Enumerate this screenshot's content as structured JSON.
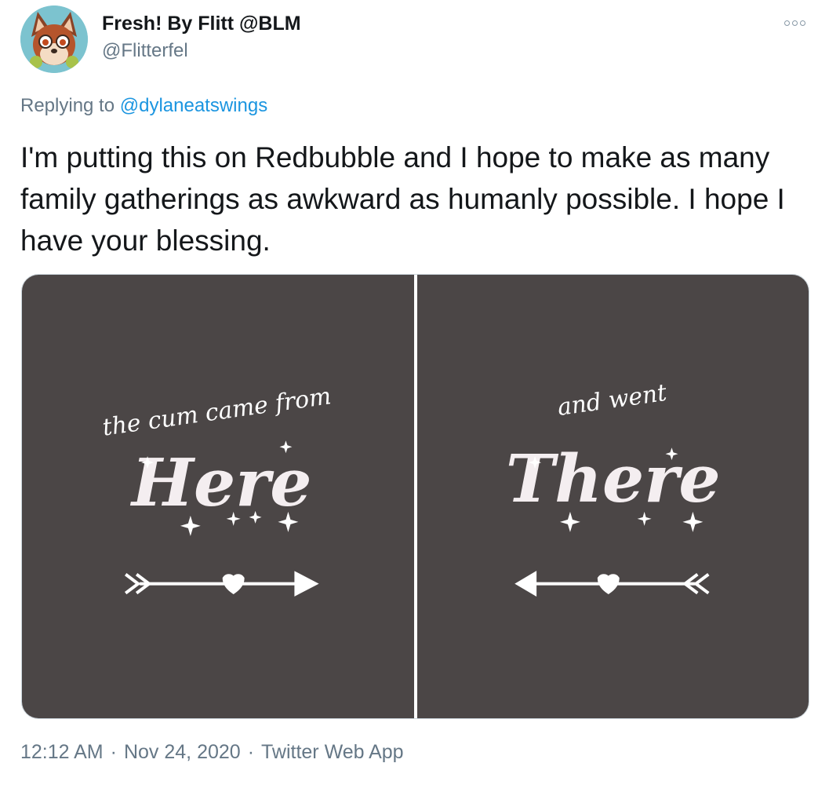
{
  "author": {
    "display_name": "Fresh! By Flitt @BLM",
    "handle": "@Flitterfel",
    "avatar_icon": "fox-character-avatar"
  },
  "more_icon": "more-options-icon",
  "reply": {
    "prefix": "Replying to ",
    "target": "@dylaneatswings"
  },
  "tweet": {
    "text": "I'm putting this on Redbubble and I hope to make as many family gatherings as awkward as humanly possible. I hope I have your blessing."
  },
  "media": {
    "left": {
      "line1": "the cum came from",
      "word": "Here"
    },
    "right": {
      "line1": "and went",
      "word": "There"
    }
  },
  "meta": {
    "time": "12:12 AM",
    "date": "Nov 24, 2020",
    "source": "Twitter Web App",
    "separator": "·"
  },
  "colors": {
    "panel_bg": "#4b4646",
    "link": "#1b95e0",
    "muted": "#657786"
  }
}
